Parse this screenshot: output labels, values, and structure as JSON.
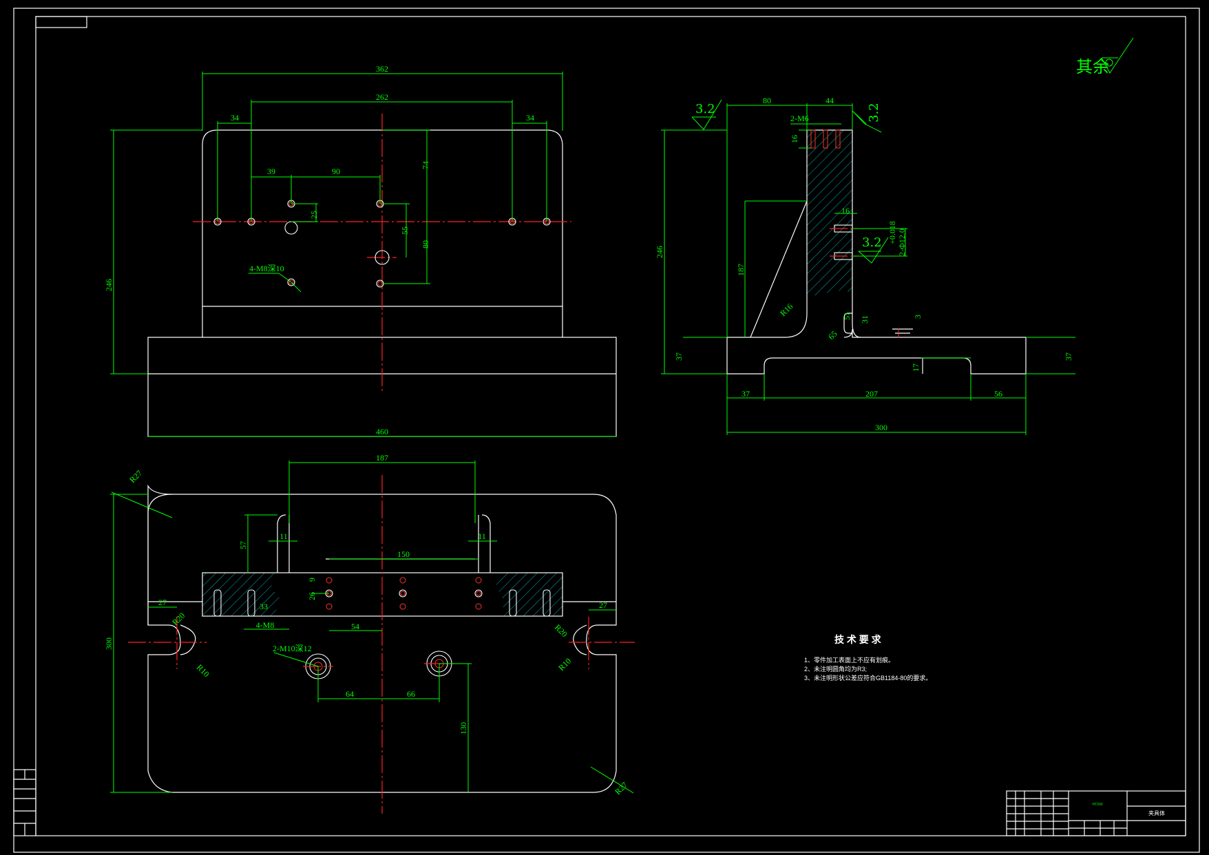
{
  "roughness_note": "其余",
  "front_view": {
    "dims": {
      "w362": "362",
      "w262": "262",
      "off34_left": "34",
      "off34_right": "34",
      "d39": "39",
      "d90": "90",
      "v74": "74",
      "v25": "25",
      "v55": "55",
      "v80": "80",
      "h246": "246",
      "w460": "460"
    },
    "callout": "4-M8深10"
  },
  "side_view": {
    "roughness_left": "3.2",
    "roughness_top": "3.2",
    "roughness_mid": "3.2",
    "dims": {
      "d80": "80",
      "d44": "44",
      "m6": "2-M6",
      "d16a": "16",
      "d16b": "16",
      "tol": "+0.018",
      "pin": "2-Φ12.0",
      "h246": "246",
      "h187": "187",
      "r16": "R16",
      "d31": "31",
      "d51": "51",
      "d3": "3",
      "d65": "65",
      "d37l": "37",
      "d37r": "37",
      "d17": "17",
      "b37": "37",
      "b207": "207",
      "b56": "56",
      "b300": "300"
    }
  },
  "top_view": {
    "dims": {
      "d187": "187",
      "d57": "57",
      "d11l": "11",
      "d11r": "11",
      "d150": "150",
      "d9": "9",
      "d26": "26",
      "d33": "33",
      "m8": "4-M8",
      "d54": "54",
      "d27l": "27",
      "d27r": "27",
      "r20l": "R20",
      "r20r": "R20",
      "r10l": "R10",
      "r10r": "R10",
      "r27a": "R27",
      "r27b": "R27",
      "m10": "2-M10深12",
      "d64": "64",
      "d66": "66",
      "d130": "130",
      "d300": "300"
    }
  },
  "tech": {
    "title": "技 术 要 求",
    "items": [
      "1、零件加工表面上不应有划痕。",
      "2、未注明圆角均为R3;",
      "3、未注明形状公差应符合GB1184-80的要求。"
    ]
  },
  "title_block": {
    "material": "HT200",
    "name": "夹具体"
  }
}
